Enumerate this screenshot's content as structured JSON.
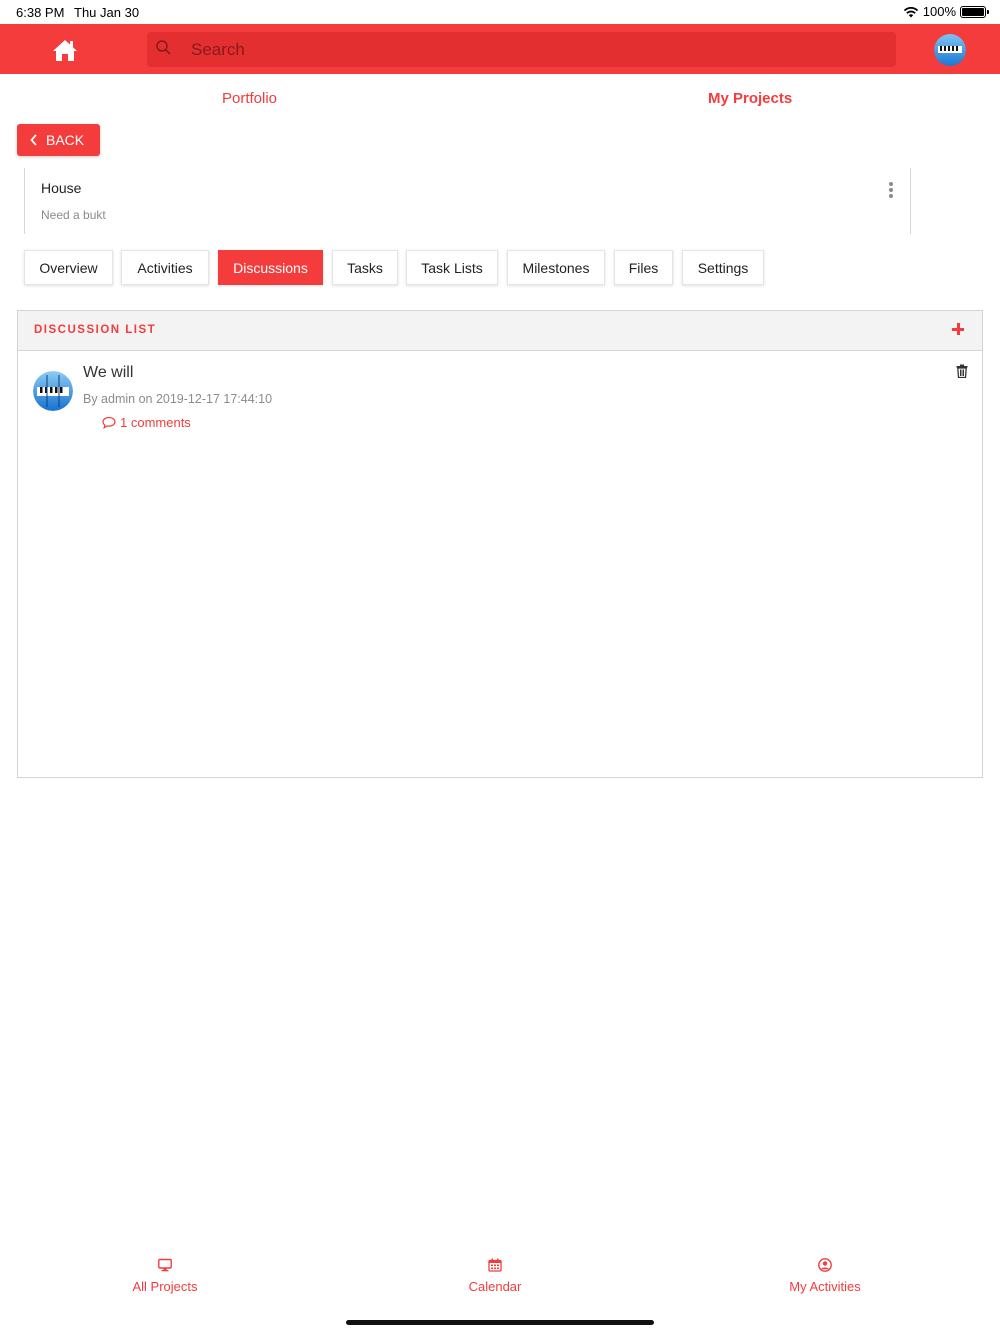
{
  "status_bar": {
    "time": "6:38 PM",
    "date": "Thu Jan 30",
    "battery": "100%"
  },
  "header": {
    "search_placeholder": "Search"
  },
  "top_tabs": {
    "portfolio": "Portfolio",
    "my_projects": "My Projects"
  },
  "back_label": "BACK",
  "project": {
    "title": "House",
    "subtitle": "Need a bukt"
  },
  "subtabs": [
    {
      "label": "Overview",
      "active": false
    },
    {
      "label": "Activities",
      "active": false
    },
    {
      "label": "Discussions",
      "active": true
    },
    {
      "label": "Tasks",
      "active": false
    },
    {
      "label": "Task Lists",
      "active": false
    },
    {
      "label": "Milestones",
      "active": false
    },
    {
      "label": "Files",
      "active": false
    },
    {
      "label": "Settings",
      "active": false
    }
  ],
  "discussion_list": {
    "title": "DISCUSSION LIST",
    "items": [
      {
        "title": "We will",
        "meta": "By admin on 2019-12-17 17:44:10",
        "comments": "1 comments"
      }
    ]
  },
  "bottom_nav": {
    "all_projects": "All Projects",
    "calendar": "Calendar",
    "my_activities": "My Activities"
  },
  "colors": {
    "accent": "#f43c3c",
    "search_bg": "#e32f2f",
    "panel_head_bg": "#f3f3f3"
  },
  "icons": [
    "home-icon",
    "search-icon",
    "avatar",
    "chevron-left-icon",
    "kebab-icon",
    "plus-icon",
    "comment-icon",
    "trash-icon",
    "monitor-icon",
    "calendar-icon",
    "user-circle-icon"
  ]
}
